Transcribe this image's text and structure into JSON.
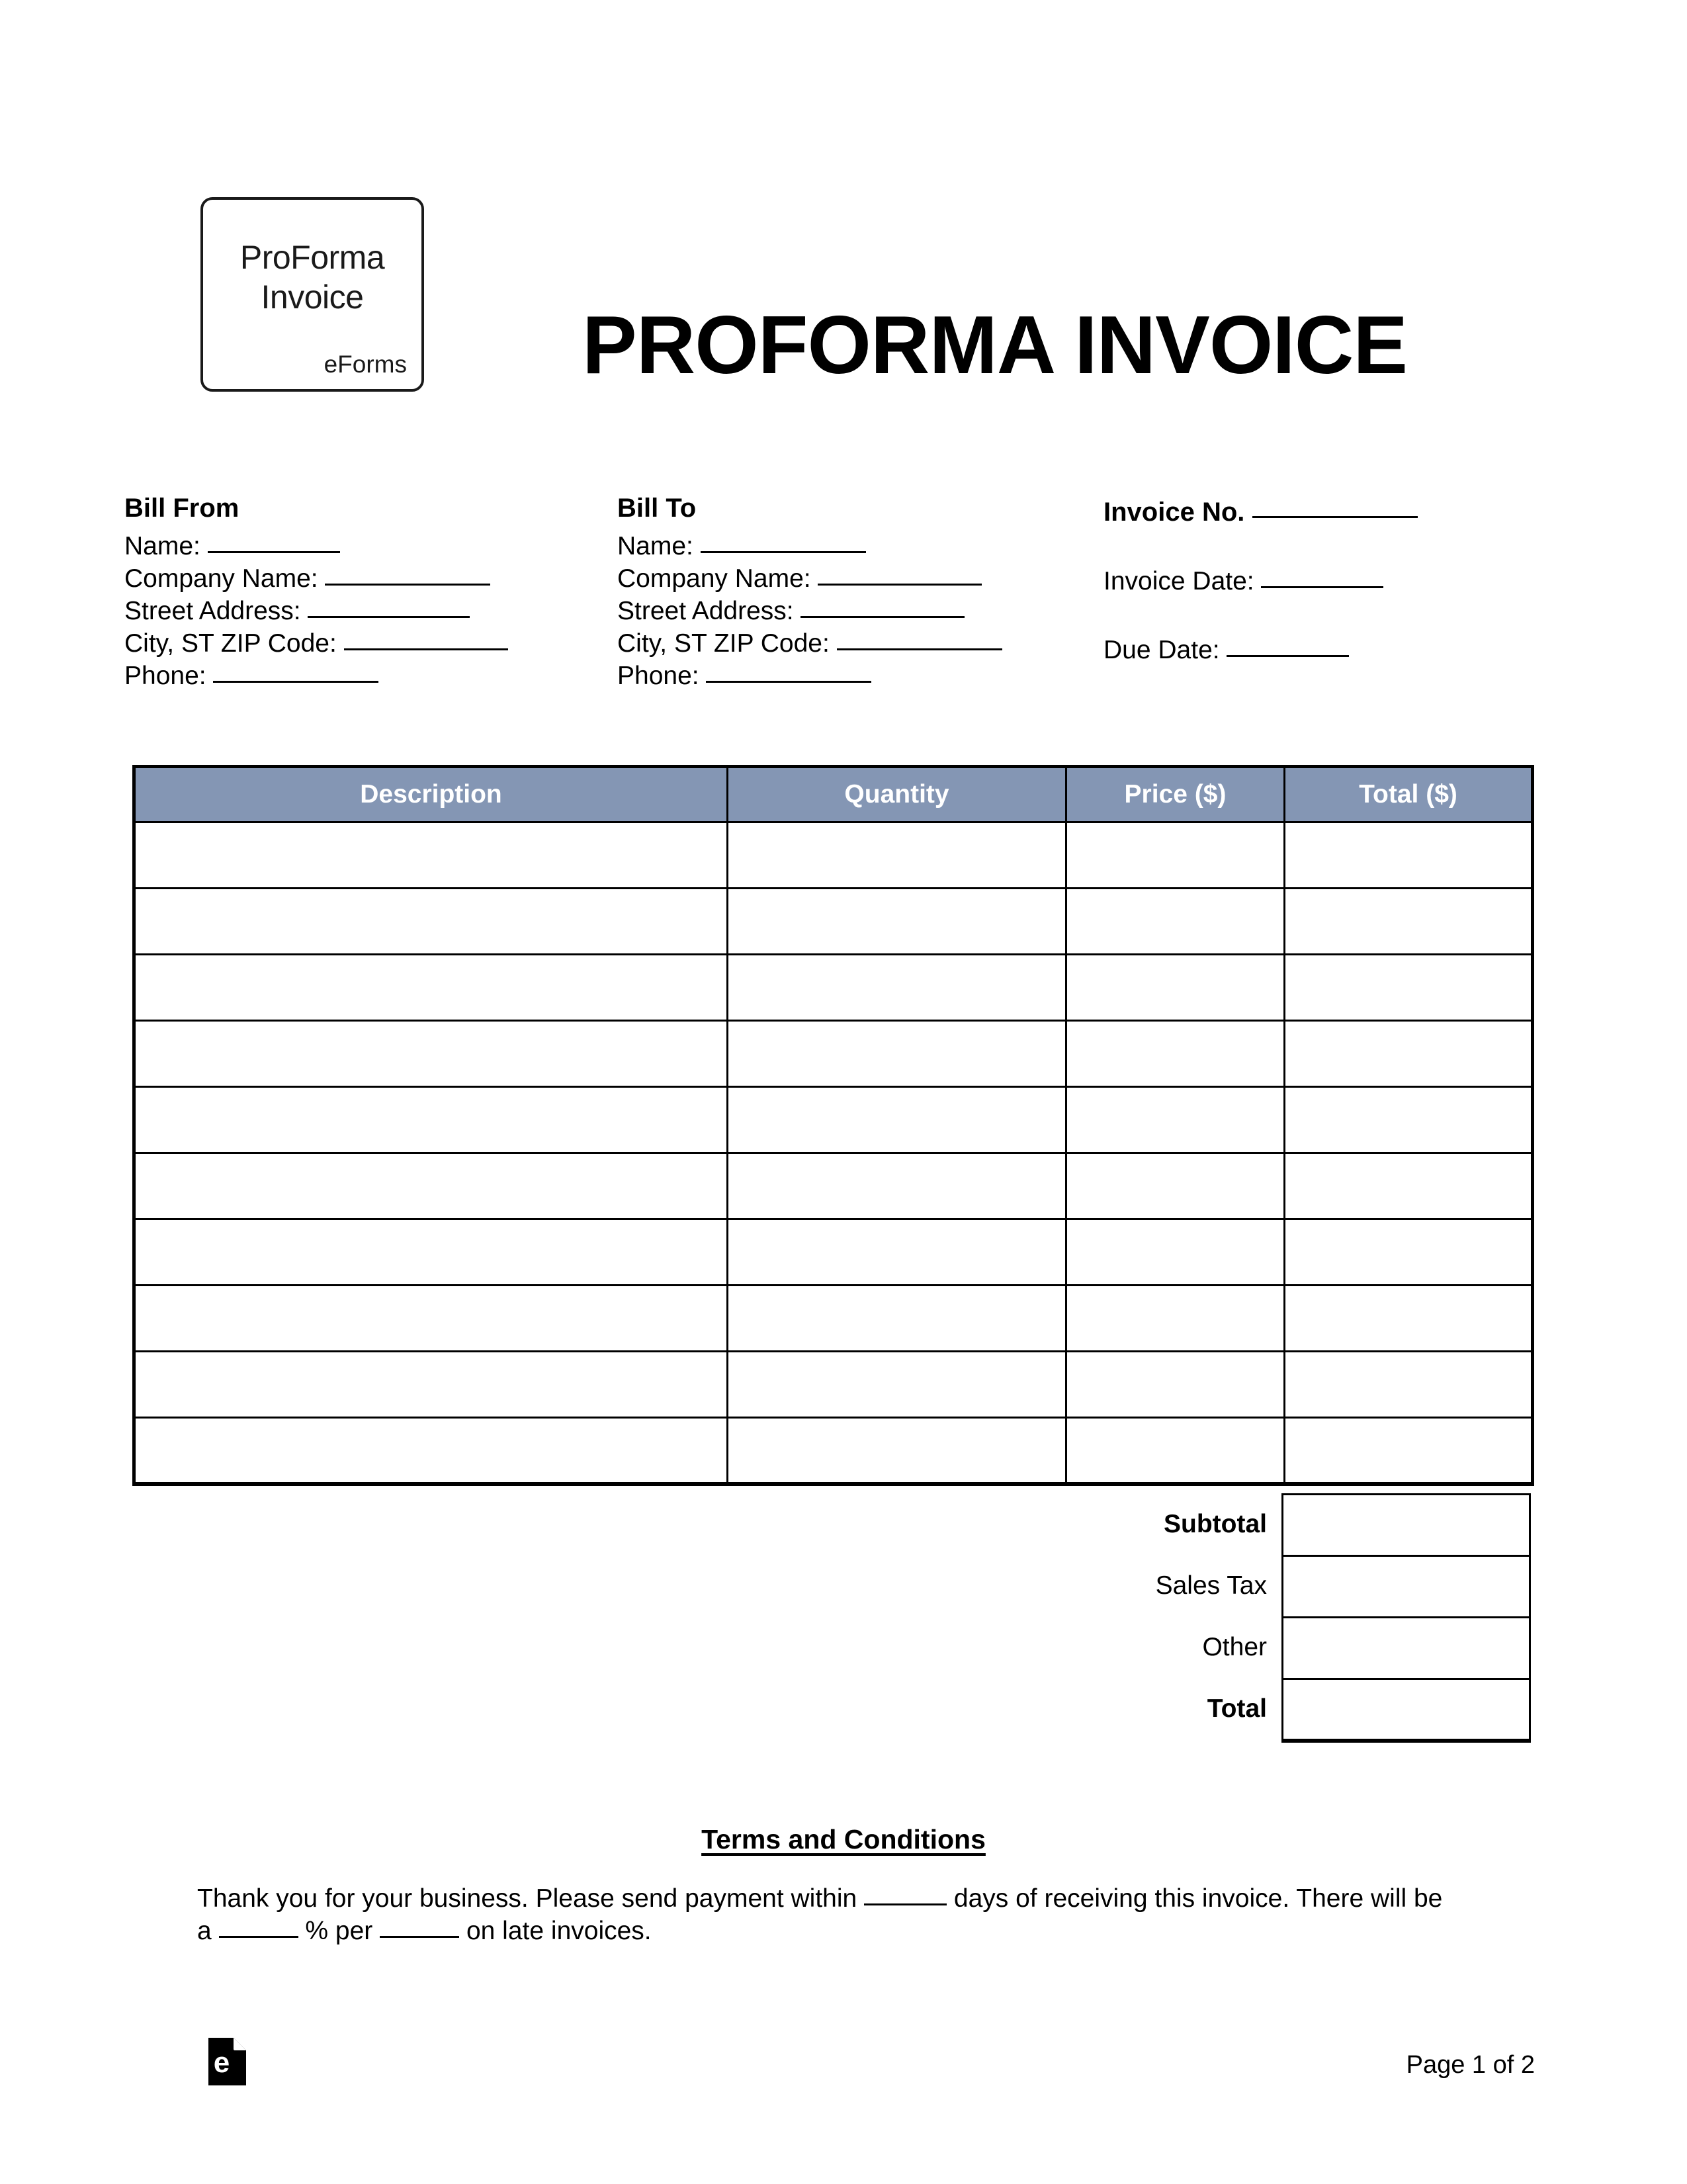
{
  "document": {
    "title": "PROFORMA INVOICE",
    "logo": {
      "line1": "ProForma",
      "line2": "Invoice",
      "brand": "eForms"
    }
  },
  "bill_from": {
    "heading": "Bill From",
    "fields": [
      {
        "label": "Name:",
        "value": ""
      },
      {
        "label": "Company Name:",
        "value": ""
      },
      {
        "label": "Street Address:",
        "value": ""
      },
      {
        "label": "City, ST ZIP Code:",
        "value": ""
      },
      {
        "label": "Phone:",
        "value": ""
      }
    ]
  },
  "bill_to": {
    "heading": "Bill To",
    "fields": [
      {
        "label": "Name:",
        "value": ""
      },
      {
        "label": "Company Name:",
        "value": ""
      },
      {
        "label": "Street Address:",
        "value": ""
      },
      {
        "label": "City, ST ZIP Code:",
        "value": ""
      },
      {
        "label": "Phone:",
        "value": ""
      }
    ]
  },
  "invoice_meta": {
    "invoice_no_label": "Invoice No.",
    "invoice_no_value": "",
    "invoice_date_label": "Invoice Date:",
    "invoice_date_value": "",
    "due_date_label": "Due Date:",
    "due_date_value": ""
  },
  "items_table": {
    "columns": [
      "Description",
      "Quantity",
      "Price ($)",
      "Total ($)"
    ],
    "header_bg": "#8496b4",
    "header_text_color": "#ffffff",
    "row_count": 10,
    "rows": [
      {
        "description": "",
        "quantity": "",
        "price": "",
        "total": ""
      },
      {
        "description": "",
        "quantity": "",
        "price": "",
        "total": ""
      },
      {
        "description": "",
        "quantity": "",
        "price": "",
        "total": ""
      },
      {
        "description": "",
        "quantity": "",
        "price": "",
        "total": ""
      },
      {
        "description": "",
        "quantity": "",
        "price": "",
        "total": ""
      },
      {
        "description": "",
        "quantity": "",
        "price": "",
        "total": ""
      },
      {
        "description": "",
        "quantity": "",
        "price": "",
        "total": ""
      },
      {
        "description": "",
        "quantity": "",
        "price": "",
        "total": ""
      },
      {
        "description": "",
        "quantity": "",
        "price": "",
        "total": ""
      },
      {
        "description": "",
        "quantity": "",
        "price": "",
        "total": ""
      }
    ]
  },
  "totals": [
    {
      "label": "Subtotal",
      "value": "",
      "bold": true
    },
    {
      "label": "Sales Tax",
      "value": "",
      "bold": false
    },
    {
      "label": "Other",
      "value": "",
      "bold": false
    },
    {
      "label": "Total",
      "value": "",
      "bold": true
    }
  ],
  "terms": {
    "title": "Terms and Conditions",
    "text_part1": "Thank you for your business. Please send payment within",
    "text_part2": "days of receiving this invoice. There will be a",
    "text_part3": "% per",
    "text_part4": "on late invoices."
  },
  "footer": {
    "brand_icon": "eforms-document-icon",
    "page_label": "Page 1 of 2"
  }
}
